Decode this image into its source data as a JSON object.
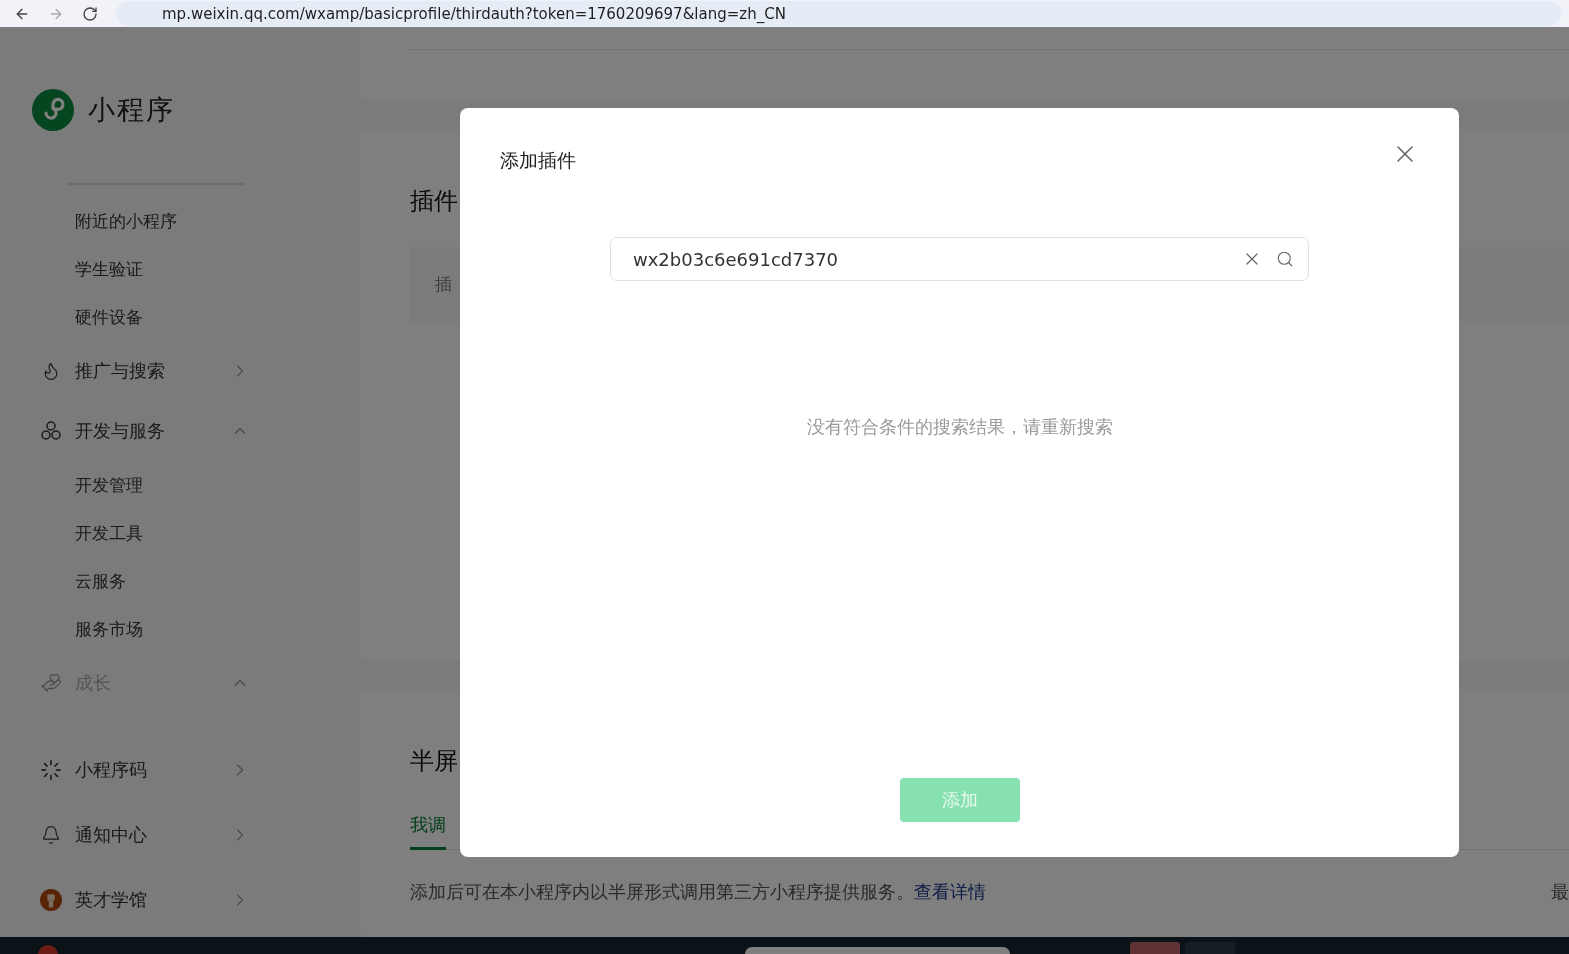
{
  "browser": {
    "url": "mp.weixin.qq.com/wxamp/basicprofile/thirdauth?token=1760209697&lang=zh_CN"
  },
  "sidebar": {
    "logo": {
      "title": "小程序"
    },
    "items": [
      {
        "kind": "sub",
        "label": "附近的小程序"
      },
      {
        "kind": "sub",
        "label": "学生验证"
      },
      {
        "kind": "sub",
        "label": "硬件设备"
      },
      {
        "kind": "group",
        "label": "推广与搜索",
        "expanded": false,
        "disabled": false
      },
      {
        "kind": "group",
        "label": "开发与服务",
        "expanded": true,
        "disabled": false,
        "children": [
          {
            "label": "开发管理"
          },
          {
            "label": "开发工具"
          },
          {
            "label": "云服务"
          },
          {
            "label": "服务市场"
          }
        ]
      },
      {
        "kind": "group",
        "label": "成长",
        "expanded": true,
        "disabled": true
      },
      {
        "kind": "link",
        "label": "小程序码"
      },
      {
        "kind": "link",
        "label": "通知中心"
      },
      {
        "kind": "link",
        "label": "英才学馆"
      }
    ]
  },
  "main": {
    "plugins": {
      "title": "插件",
      "note": "插"
    },
    "half_screen": {
      "title": "半屏",
      "tab": {
        "label": "我调",
        "selected": true
      },
      "description": "添加后可在本小程序内以半屏形式调用第三方小程序提供服务。",
      "link": "查看详情",
      "column_2": "最"
    }
  },
  "dialog": {
    "title": "添加插件",
    "search": {
      "value": "wx2b03c6e691cd7370"
    },
    "empty_message": "没有符合条件的搜索结果，请重新搜索",
    "button": {
      "label": "添加",
      "disabled": true
    }
  }
}
